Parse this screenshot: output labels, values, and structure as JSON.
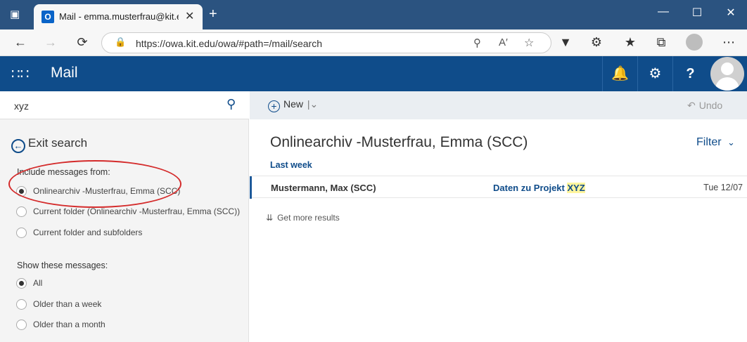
{
  "browser": {
    "tab_title": "emma.musterfrau@kit.edu",
    "tab_prefix": "Mail - ",
    "url": "https://owa.kit.edu/owa/#path=/mail/search"
  },
  "header": {
    "app_title": "Mail"
  },
  "search": {
    "value": "xyz"
  },
  "left_pane": {
    "exit_search": "Exit search",
    "include_label": "Include messages from:",
    "include_options": [
      {
        "label": "Onlinearchiv -Musterfrau, Emma (SCC)",
        "selected": true
      },
      {
        "label": "Current folder (Onlinearchiv -Musterfrau, Emma (SCC))",
        "selected": false
      },
      {
        "label": "Current folder and subfolders",
        "selected": false
      }
    ],
    "show_label": "Show these messages:",
    "show_options": [
      {
        "label": "All",
        "selected": true
      },
      {
        "label": "Older than a week",
        "selected": false
      },
      {
        "label": "Older than a month",
        "selected": false
      }
    ]
  },
  "toolbar": {
    "new_label": "New",
    "undo_label": "Undo"
  },
  "main": {
    "folder_title": "Onlinearchiv -Musterfrau, Emma (SCC)",
    "filter_label": "Filter",
    "group_label": "Last week",
    "messages": [
      {
        "sender": "Mustermann, Max (SCC)",
        "subject_prefix": "Daten zu Projekt ",
        "subject_highlight": "XYZ",
        "date": "Tue 12/07"
      }
    ],
    "more_results": "Get more results"
  },
  "colors": {
    "owa_header": "#0f4c8a",
    "browser_frame": "#2b5380",
    "annotation": "#d42b2b"
  }
}
